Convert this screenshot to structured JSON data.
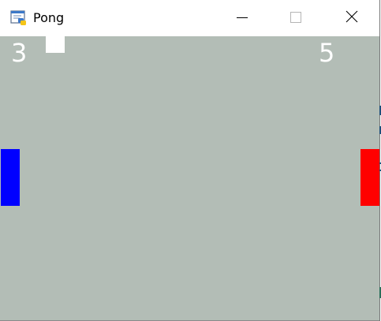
{
  "window": {
    "title": "Pong",
    "icon": "python-window-icon"
  },
  "controls": {
    "minimize_icon": "minimize-icon",
    "maximize_icon": "maximize-icon",
    "close_icon": "close-icon"
  },
  "game": {
    "background_color": "#b3bdb6",
    "score_left": "3",
    "score_right": "5",
    "ball_color": "#ffffff",
    "left_paddle_color": "#0000ff",
    "right_paddle_color": "#ff0000"
  }
}
